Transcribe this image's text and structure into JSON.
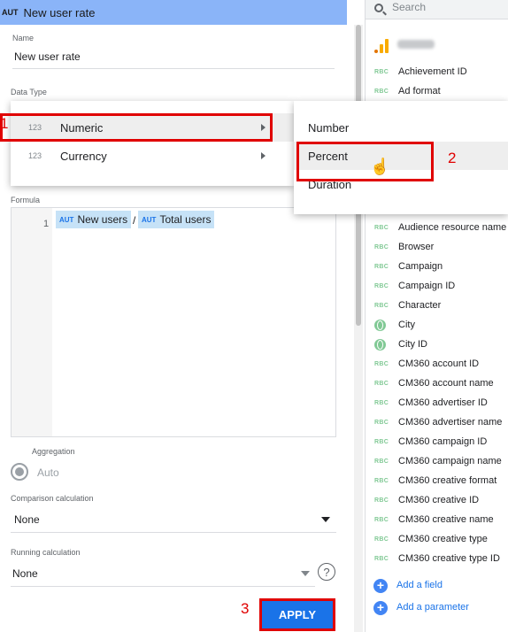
{
  "editor": {
    "type_badge": "AUT",
    "title": "New user rate",
    "name_label": "Name",
    "name_value": "New user rate",
    "data_type_label": "Data Type",
    "formula_label": "Formula",
    "formula_line": "1",
    "formula_chips": [
      {
        "type": "AUT",
        "text": "New users"
      },
      {
        "type": "AUT",
        "text": "Total users"
      }
    ],
    "operator": "/",
    "aggregation_label": "Aggregation",
    "aggregation_value": "Auto",
    "comparison_label": "Comparison calculation",
    "comparison_value": "None",
    "running_label": "Running calculation",
    "running_value": "None",
    "help_glyph": "?",
    "apply_label": "APPLY"
  },
  "type_menu": {
    "items": [
      {
        "icon": "123",
        "label": "Numeric"
      },
      {
        "icon": "123",
        "label": "Currency"
      }
    ]
  },
  "sub_menu": {
    "items": [
      "Number",
      "Percent",
      "Duration"
    ]
  },
  "steps": [
    "1",
    "2",
    "3"
  ],
  "fields_panel": {
    "search_placeholder": "Search",
    "type_tag": "RBC",
    "fields": [
      "Achievement ID",
      "Ad format",
      "Audience resource name",
      "Browser",
      "Campaign",
      "Campaign ID",
      "Character",
      "City",
      "City ID",
      "CM360 account ID",
      "CM360 account name",
      "CM360 advertiser ID",
      "CM360 advertiser name",
      "CM360 campaign ID",
      "CM360 campaign name",
      "CM360 creative format",
      "CM360 creative ID",
      "CM360 creative name",
      "CM360 creative type",
      "CM360 creative type ID"
    ],
    "add_field": "Add a field",
    "add_parameter": "Add a parameter"
  },
  "colors": {
    "title_bar": "#8ab4f8",
    "apply": "#1a73e8",
    "highlight": "#e00000",
    "chip": "#c6e2f7",
    "dimension": "#81c995"
  }
}
